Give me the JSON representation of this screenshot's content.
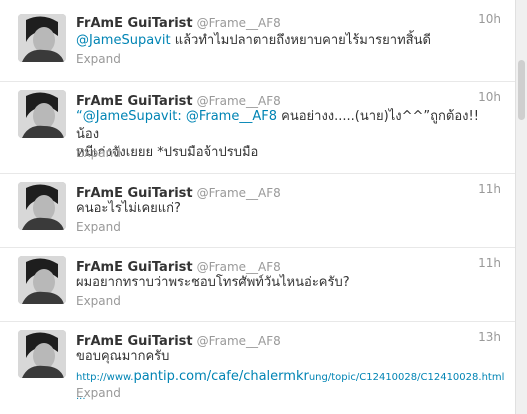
{
  "tweets": [
    {
      "fullname": "FrAmE GuiTarist",
      "screenname": "@Frame__AF8",
      "time": "10h",
      "mention1": "@JameSupavit",
      "text": " แล้วทำไมปลาตายถึงหยาบคายไร้มารยาทสิ้นดี",
      "expand": "Expand"
    },
    {
      "fullname": "FrAmE GuiTarist",
      "screenname": "@Frame__AF8",
      "time": "10h",
      "prefix": "“",
      "mention1": "@JameSupavit",
      "mention2": "@Frame__AF8",
      "sep": ": ",
      "line1": " คนอย่างง.....(นาย)ไง^^”ถูกต้อง!! น้อง",
      "line2": "หมีเก่งจังเยยย *ปรบมือจ้าปรบมือ",
      "expand": "Expand"
    },
    {
      "fullname": "FrAmE GuiTarist",
      "screenname": "@Frame__AF8",
      "time": "11h",
      "text": "คนอะไรไม่เคยแก่?",
      "expand": "Expand"
    },
    {
      "fullname": "FrAmE GuiTarist",
      "screenname": "@Frame__AF8",
      "time": "11h",
      "text": "ผมอยากทราบว่าพระชอบโทรศัพท์วันไหนอ่ะครับ?",
      "expand": "Expand"
    },
    {
      "fullname": "FrAmE GuiTarist",
      "screenname": "@Frame__AF8",
      "time": "13h",
      "text": "ขอบคุณมากครับ",
      "link_pre": "http://www.",
      "link_main": "pantip.com/cafe/chalermkr",
      "link_post": "ung/topic/C12410028/C12410028.html ...",
      "expand": "Expand"
    }
  ],
  "colors": {
    "link": "#0084b4",
    "meta": "#999999",
    "text": "#333333",
    "divider": "#e8e8e8"
  }
}
